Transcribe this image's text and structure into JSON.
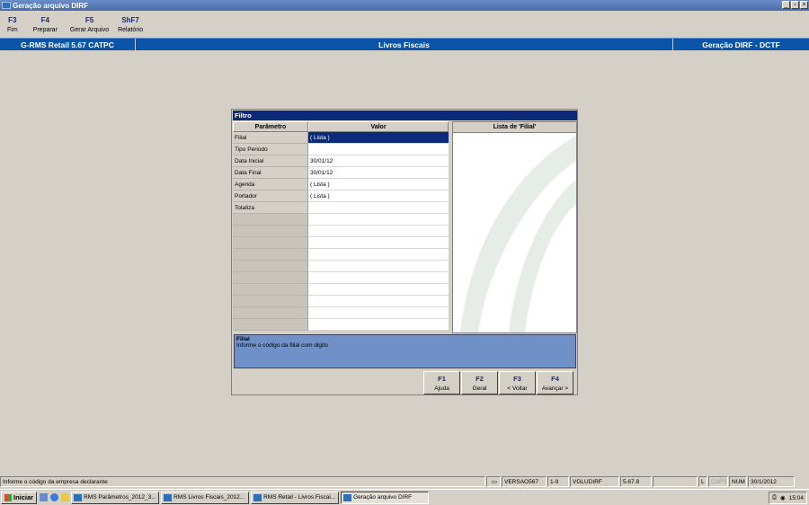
{
  "window": {
    "title": "Geração arquivo DIRF"
  },
  "toolbar": [
    {
      "key": "F3",
      "label": "Fim"
    },
    {
      "key": "F4",
      "label": "Preparar"
    },
    {
      "key": "F5",
      "label": "Gerar Arquivo"
    },
    {
      "key": "ShF7",
      "label": "Relatório"
    }
  ],
  "header": {
    "left": "G-RMS Retail 5.67 CATPC",
    "center": "Livros Fiscais",
    "right": "Geração DIRF - DCTF"
  },
  "dialog": {
    "title": "Filtro",
    "col_param": "Parâmetro",
    "col_value": "Valor",
    "list_title": "Lista de 'Filial'",
    "rows": [
      {
        "param": "Filial",
        "value": "( Lista )"
      },
      {
        "param": "Tipo Periodo",
        "value": ""
      },
      {
        "param": "Data Inicial",
        "value": "30/01/12"
      },
      {
        "param": "Data Final",
        "value": "30/01/12"
      },
      {
        "param": "Agenda",
        "value": "( Lista )"
      },
      {
        "param": "Portador",
        "value": "( Lista )"
      },
      {
        "param": "Totaliza",
        "value": ""
      },
      {
        "param": "",
        "value": ""
      },
      {
        "param": "",
        "value": ""
      },
      {
        "param": "",
        "value": ""
      },
      {
        "param": "",
        "value": ""
      },
      {
        "param": "",
        "value": ""
      },
      {
        "param": "",
        "value": ""
      },
      {
        "param": "",
        "value": ""
      },
      {
        "param": "",
        "value": ""
      },
      {
        "param": "",
        "value": ""
      },
      {
        "param": "",
        "value": ""
      }
    ],
    "help_title": "Filial",
    "help_text": "Informe o código da filial com digito",
    "buttons": [
      {
        "key": "F1",
        "label": "Ajuda"
      },
      {
        "key": "F2",
        "label": "Geral"
      },
      {
        "key": "F3",
        "label": "< Voltar"
      },
      {
        "key": "F4",
        "label": "Avançar >"
      }
    ]
  },
  "status": {
    "message": "Informe o código da empresa declarante",
    "version": "VERSAO567",
    "range": "1-9",
    "user": "VGLUDIRF",
    "build": "5.67.8",
    "l": "L",
    "caps": "CAPS",
    "num": "NUM",
    "date": "30/1/2012"
  },
  "taskbar": {
    "start": "Iniciar",
    "tasks": [
      "RMS Parâmetros_2012_3...",
      "RMS Livros Fiscais_2012...",
      "RMS Retail - Livros Fiscai...",
      "Geração arquivo DIRF"
    ],
    "time": "15:04"
  }
}
